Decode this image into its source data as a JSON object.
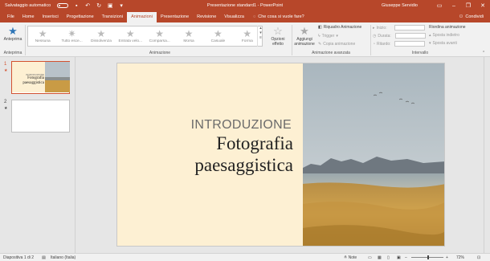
{
  "titlebar": {
    "autosave_label": "Salvataggio automatico",
    "autosave_state": "off",
    "title": "Presentazione standard1 - PowerPoint",
    "user": "Giuseppe Servidio",
    "accent": "#b7472a"
  },
  "tabs": [
    {
      "label": "File"
    },
    {
      "label": "Home"
    },
    {
      "label": "Inserisci"
    },
    {
      "label": "Progettazione"
    },
    {
      "label": "Transizioni"
    },
    {
      "label": "Animazioni",
      "active": true
    },
    {
      "label": "Presentazione"
    },
    {
      "label": "Revisione"
    },
    {
      "label": "Visualizza"
    }
  ],
  "tell_me": "Che cosa si vuole fare?",
  "share": "Condividi",
  "ribbon": {
    "preview_label": "Anteprima",
    "gallery": [
      "Nessuna",
      "Tutto esce...",
      "Dissolvenza",
      "Entrata velo...",
      "Comparsa...",
      "Morsa",
      "Casuale",
      "Forma"
    ],
    "effect_options": "Opzioni effetto",
    "add_animation": "Aggiungi animazione",
    "animation_pane": "Riquadro Animazione",
    "trigger": "Trigger",
    "animation_painter": "Copia animazione",
    "start_label": "Inizio:",
    "duration_label": "Durata:",
    "delay_label": "Ritardo:",
    "reorder_title": "Riordina animazione",
    "move_earlier": "Sposta indietro",
    "move_later": "Sposta avanti",
    "groups": {
      "preview": "Anteprima",
      "animation": "Animazione",
      "advanced": "Animazione avanzata",
      "timing": "Intervallo"
    }
  },
  "slides": [
    {
      "number": "1",
      "star": "★",
      "thumb_sub": "INTRODUZIONE",
      "thumb_title": "Fotografia paesaggistica"
    },
    {
      "number": "2",
      "star": "★"
    }
  ],
  "slide": {
    "subtitle": "INTRODUZIONE",
    "title": "Fotografia paesaggistica",
    "left_bg": "#fdf0d3"
  },
  "status": {
    "slide_info": "Diapositiva 1 di 2",
    "language": "Italiano (Italia)",
    "notes": "Note",
    "zoom": "72%"
  }
}
